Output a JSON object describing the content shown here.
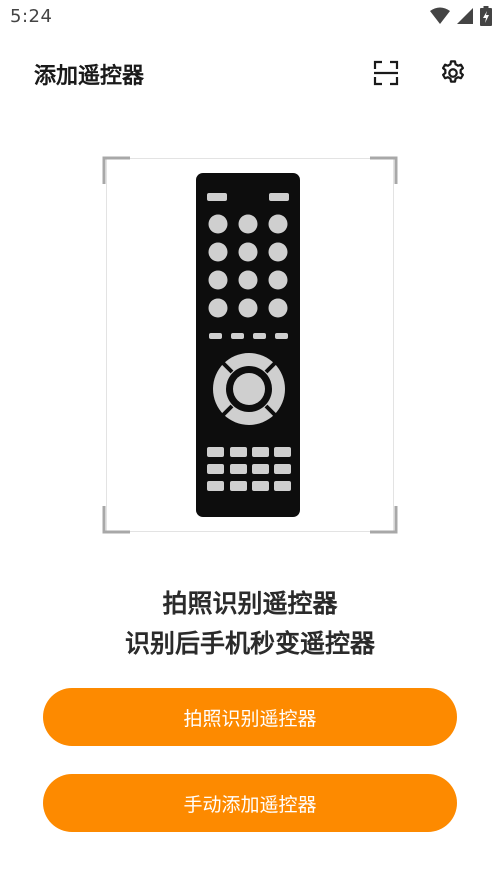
{
  "status_bar": {
    "time": "5:24"
  },
  "app_bar": {
    "title": "添加遥控器"
  },
  "hero": {
    "line1": "拍照识别遥控器",
    "line2": "识别后手机秒变遥控器"
  },
  "actions": {
    "photo_label": "拍照识别遥控器",
    "manual_label": "手动添加遥控器"
  },
  "colors": {
    "accent": "#fd8a00"
  },
  "icons": {
    "scan": "scan-icon",
    "settings": "gear-icon"
  }
}
